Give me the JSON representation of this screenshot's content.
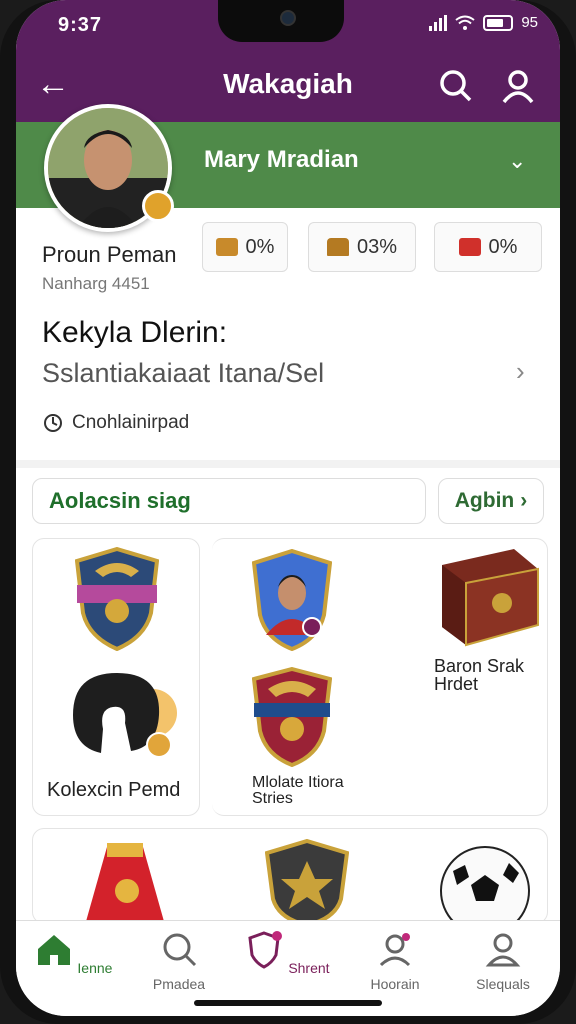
{
  "status": {
    "time": "9:37",
    "battery": "95"
  },
  "header": {
    "title": "Wakagiah"
  },
  "banner": {
    "name": "Mary Mradian"
  },
  "profile": {
    "name": "Proun Peman",
    "id": "Nanharg 4451"
  },
  "stats": [
    {
      "value": "0%",
      "color": "#c88a2b",
      "icon": "badge-icon"
    },
    {
      "value": "03%",
      "color": "#b47a22",
      "icon": "trophy-icon"
    },
    {
      "value": "0%",
      "color": "#d0302b",
      "icon": "flag-icon"
    }
  ],
  "section": {
    "title": "Kekyla Dlerin:",
    "subtitle": "Sslantiakaiaat Itana/Sel",
    "note": "Cnohlainirpad"
  },
  "collection": {
    "label": "Aolacsin siag",
    "add_label": "Agbin"
  },
  "items": [
    {
      "label": "Kolexcin Pemd",
      "icon": "shield-icon"
    },
    {
      "label": "Mlolate Itiora Stries",
      "icon": "player-card-icon"
    },
    {
      "label": "Baron Srak Hrdet",
      "icon": "book-icon"
    }
  ],
  "nav": [
    {
      "label": "Ienne",
      "icon": "home-icon",
      "active": true
    },
    {
      "label": "Pmadea",
      "icon": "search-icon",
      "active": false
    },
    {
      "label": "Shrent",
      "icon": "shield-badge-icon",
      "active": false
    },
    {
      "label": "Hoorain",
      "icon": "profile-icon",
      "active": false
    },
    {
      "label": "Slequals",
      "icon": "person-icon",
      "active": false
    }
  ],
  "colors": {
    "purple": "#5a1f5f",
    "green": "#4f8a49",
    "active_nav": "#2e7d32",
    "nav_purple": "#7a1f5a"
  }
}
